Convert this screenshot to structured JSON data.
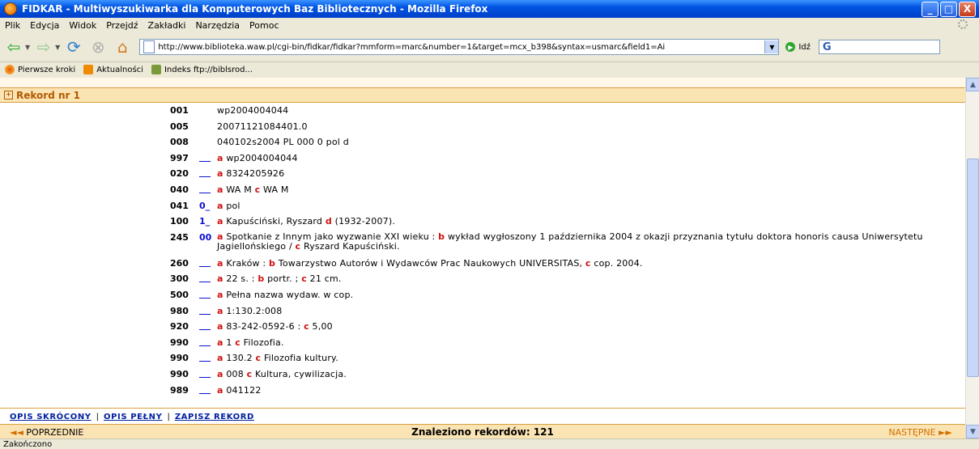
{
  "window": {
    "title": "FIDKAR - Multiwyszukiwarka dla Komputerowych Baz Bibliotecznych - Mozilla Firefox",
    "minimize": "_",
    "maximize": "□",
    "close": "X"
  },
  "menu": [
    "Plik",
    "Edycja",
    "Widok",
    "Przejdź",
    "Zakładki",
    "Narzędzia",
    "Pomoc"
  ],
  "toolbar": {
    "url": "http://www.biblioteka.waw.pl/cgi-bin/fidkar/fidkar?mmform=marc&number=1&target=mcx_b398&syntax=usmarc&field1=Ai",
    "go_label": "Idź",
    "search_logo": "G"
  },
  "bookmarks": [
    "Pierwsze kroki",
    "Aktualności",
    "Indeks ftp://biblsrod..."
  ],
  "record_header": "Rekord nr 1",
  "marc_fields": [
    {
      "tag": "001",
      "ind": "",
      "value": "wp2004004044",
      "plain": true
    },
    {
      "tag": "005",
      "ind": "",
      "value": "20071121084401.0",
      "plain": true
    },
    {
      "tag": "008",
      "ind": "",
      "value": "040102s2004 PL 000 0 pol d",
      "plain": true
    },
    {
      "tag": "997",
      "ind": "__",
      "subfields": [
        {
          "code": "a",
          "text": " wp2004004044"
        }
      ]
    },
    {
      "tag": "020",
      "ind": "__",
      "subfields": [
        {
          "code": "a",
          "text": " 8324205926"
        }
      ]
    },
    {
      "tag": "040",
      "ind": "__",
      "subfields": [
        {
          "code": "a",
          "text": " WA M "
        },
        {
          "code": "c",
          "text": " WA M"
        }
      ]
    },
    {
      "tag": "041",
      "ind": "0_",
      "subfields": [
        {
          "code": "a",
          "text": " pol"
        }
      ]
    },
    {
      "tag": "100",
      "ind": "1_",
      "subfields": [
        {
          "code": "a",
          "text": " Kapuściński, Ryszard "
        },
        {
          "code": "d",
          "text": " (1932-2007)."
        }
      ]
    },
    {
      "tag": "245",
      "ind": "00",
      "tall": true,
      "subfields": [
        {
          "code": "a",
          "text": " Spotkanie z Innym jako wyzwanie XXI wieku : "
        },
        {
          "code": "b",
          "text": " wykład wygłoszony 1 października 2004 z okazji przyznania tytułu doktora honoris causa Uniwersytetu Jagiellońskiego / "
        },
        {
          "code": "c",
          "text": " Ryszard Kapuściński."
        }
      ]
    },
    {
      "tag": "260",
      "ind": "__",
      "subfields": [
        {
          "code": "a",
          "text": " Kraków : "
        },
        {
          "code": "b",
          "text": " Towarzystwo Autorów i Wydawców Prac Naukowych UNIVERSITAS, "
        },
        {
          "code": "c",
          "text": " cop. 2004."
        }
      ]
    },
    {
      "tag": "300",
      "ind": "__",
      "subfields": [
        {
          "code": "a",
          "text": " 22 s. : "
        },
        {
          "code": "b",
          "text": " portr. ; "
        },
        {
          "code": "c",
          "text": " 21 cm."
        }
      ]
    },
    {
      "tag": "500",
      "ind": "__",
      "subfields": [
        {
          "code": "a",
          "text": " Pełna nazwa wydaw. w cop."
        }
      ]
    },
    {
      "tag": "980",
      "ind": "__",
      "subfields": [
        {
          "code": "a",
          "text": " 1:130.2:008"
        }
      ]
    },
    {
      "tag": "920",
      "ind": "__",
      "subfields": [
        {
          "code": "a",
          "text": " 83-242-0592-6 : "
        },
        {
          "code": "c",
          "text": " 5,00"
        }
      ]
    },
    {
      "tag": "990",
      "ind": "__",
      "subfields": [
        {
          "code": "a",
          "text": " 1 "
        },
        {
          "code": "c",
          "text": " Filozofia."
        }
      ]
    },
    {
      "tag": "990",
      "ind": "__",
      "subfields": [
        {
          "code": "a",
          "text": " 130.2 "
        },
        {
          "code": "c",
          "text": " Filozofia kultury."
        }
      ]
    },
    {
      "tag": "990",
      "ind": "__",
      "subfields": [
        {
          "code": "a",
          "text": " 008 "
        },
        {
          "code": "c",
          "text": " Kultura, cywilizacja."
        }
      ]
    },
    {
      "tag": "989",
      "ind": "__",
      "subfields": [
        {
          "code": "a",
          "text": " 041122"
        }
      ]
    }
  ],
  "links": {
    "short": "OPIS SKRÓCONY",
    "full": "OPIS PEŁNY",
    "save": "ZAPISZ REKORD",
    "separator": "|"
  },
  "pager": {
    "prev": "POPRZEDNIE",
    "prev_arrows": "◄◄",
    "count": "Znaleziono rekordów: 121",
    "next": "NASTĘPNE",
    "next_arrows": "►►"
  },
  "status": "Zakończono"
}
